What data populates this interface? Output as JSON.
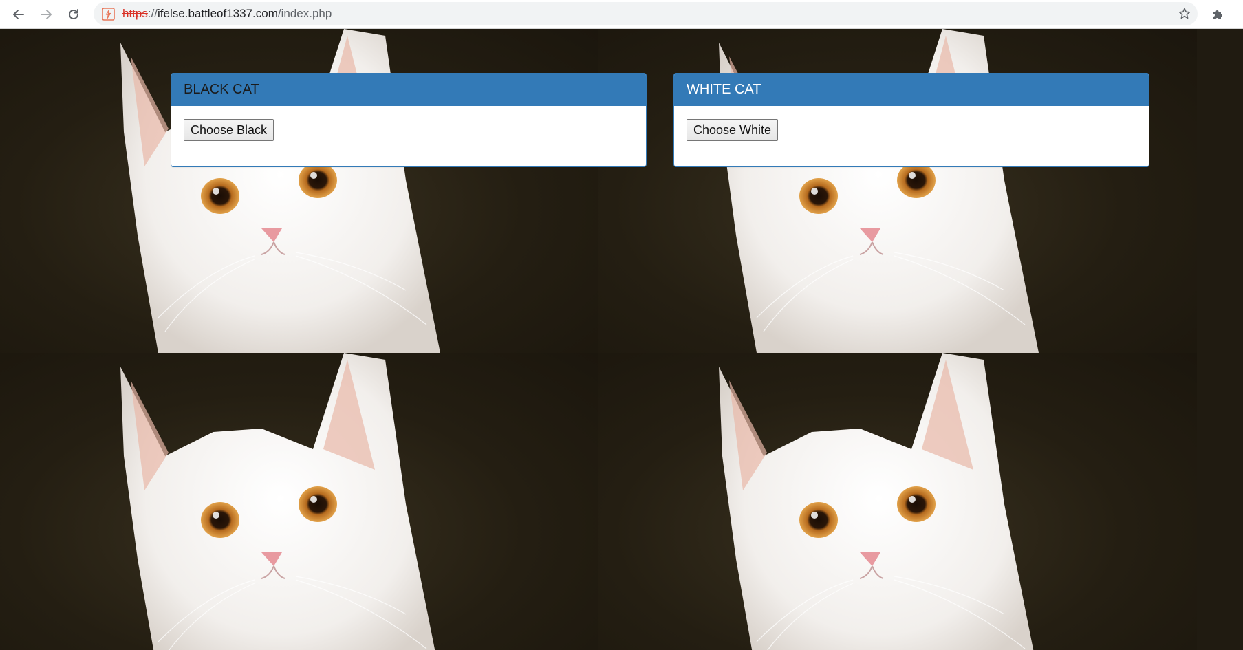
{
  "browser": {
    "url_scheme": "https",
    "url_sep": "://",
    "url_host": "ifelse.battleof1337.com",
    "url_path": "/index.php",
    "icons": {
      "back": "back-arrow-icon",
      "forward": "forward-arrow-icon",
      "reload": "reload-icon",
      "site": "not-secure-site-icon",
      "bookmark": "star-icon",
      "extensions": "puzzle-icon"
    }
  },
  "panels": [
    {
      "heading": "BLACK CAT",
      "button_label": "Choose Black"
    },
    {
      "heading": "WHITE CAT",
      "button_label": "Choose White"
    }
  ],
  "colors": {
    "panel_primary": "#337ab7",
    "background_dark": "#201b11",
    "insecure_scheme": "#d93025"
  }
}
